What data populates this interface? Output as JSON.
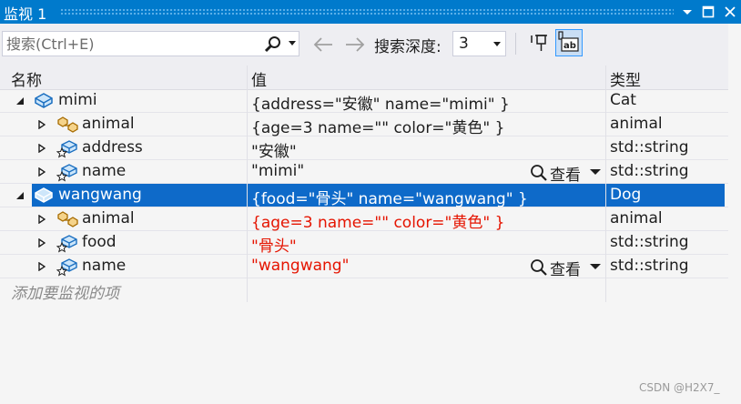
{
  "window": {
    "title": "监视 1"
  },
  "toolbar": {
    "search_placeholder": "搜索(Ctrl+E)",
    "depth_label": "搜索深度:",
    "depth_value": "3"
  },
  "columns": {
    "name": "名称",
    "value": "值",
    "type": "类型"
  },
  "rows": [
    {
      "name": "mimi",
      "value": "{address=\"安徽\" name=\"mimi\" }",
      "type": "Cat",
      "icon": "class-object-icon",
      "level": 0,
      "expanded": true
    },
    {
      "name": "animal",
      "value": "{age=3 name=\"\" color=\"黄色\" }",
      "type": "animal",
      "icon": "base-class-icon",
      "level": 1
    },
    {
      "name": "address",
      "value": "\"安徽\"",
      "type": "std::string",
      "icon": "field-icon",
      "level": 1
    },
    {
      "name": "name",
      "value": "\"mimi\"",
      "type": "std::string",
      "icon": "field-icon",
      "level": 1,
      "view_label": "查看"
    },
    {
      "name": "wangwang",
      "value": "{food=\"骨头\" name=\"wangwang\" }",
      "type": "Dog",
      "icon": "class-object-icon",
      "level": 0,
      "expanded": true,
      "selected": true
    },
    {
      "name": "animal",
      "value": "{age=3 name=\"\" color=\"黄色\" }",
      "type": "animal",
      "icon": "base-class-icon",
      "level": 1,
      "changed": true
    },
    {
      "name": "food",
      "value": "\"骨头\"",
      "type": "std::string",
      "icon": "field-icon",
      "level": 1,
      "changed": true
    },
    {
      "name": "name",
      "value": "\"wangwang\"",
      "type": "std::string",
      "icon": "field-icon",
      "level": 1,
      "changed": true,
      "view_label": "查看"
    }
  ],
  "add_watch_placeholder": "添加要监视的项",
  "watermark": "CSDN @H2X7_",
  "colors": {
    "accent": "#007acc",
    "selection": "#0e6ac9",
    "changed_value": "#e51400"
  }
}
